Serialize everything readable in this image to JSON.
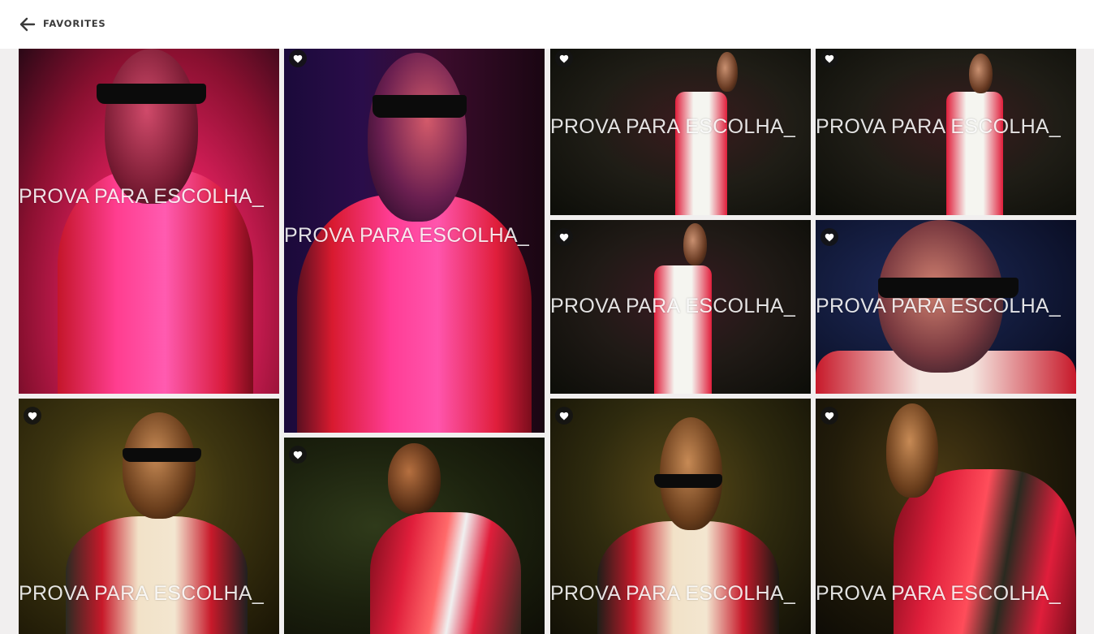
{
  "header": {
    "back_icon": "arrow-left-icon",
    "title": "FAVORITES"
  },
  "colors": {
    "topbar_bg": "#ffffff",
    "page_bg": "#f1efef",
    "title_text": "#3a3a3a",
    "favorite_badge_bg": "#141414",
    "favorite_icon": "#ffffff"
  },
  "gallery": {
    "watermark": "PROVA PARA ESCOLHA_",
    "photos": [
      {
        "id": "p1",
        "theme": "magenta",
        "favorite_icon": false
      },
      {
        "id": "p2",
        "theme": "magenta-blue",
        "favorite_icon": true
      },
      {
        "id": "p3",
        "theme": "dark-full",
        "favorite_icon": true
      },
      {
        "id": "p4",
        "theme": "dark-full",
        "favorite_icon": true
      },
      {
        "id": "p5",
        "theme": "dark-full",
        "favorite_icon": true
      },
      {
        "id": "p6",
        "theme": "navy-close",
        "favorite_icon": true
      },
      {
        "id": "p7",
        "theme": "olive",
        "favorite_icon": true
      },
      {
        "id": "p8",
        "theme": "dark-green",
        "favorite_icon": true
      },
      {
        "id": "p9",
        "theme": "olive",
        "favorite_icon": true
      },
      {
        "id": "p10",
        "theme": "olive-dark",
        "favorite_icon": true
      }
    ]
  }
}
